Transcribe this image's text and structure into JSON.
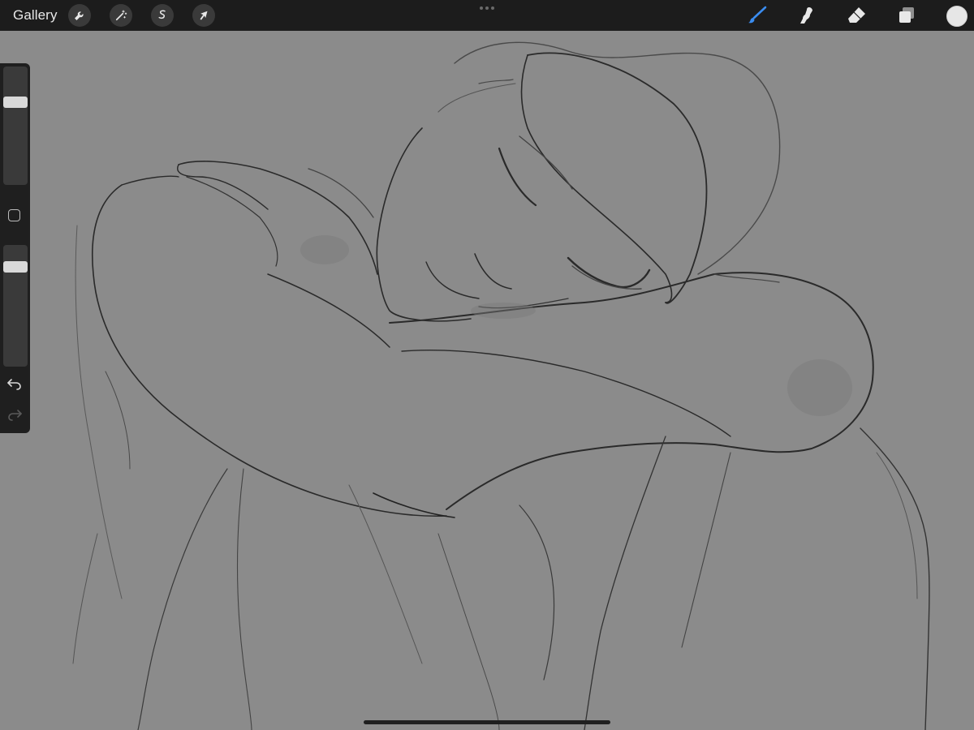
{
  "app": {
    "gallery_label": "Gallery"
  },
  "toolbar": {
    "left_tools": [
      {
        "name": "actions",
        "icon": "wrench-icon"
      },
      {
        "name": "adjustments",
        "icon": "magic-wand-icon"
      },
      {
        "name": "selection",
        "icon": "selection-s-icon"
      },
      {
        "name": "transform",
        "icon": "arrow-cursor-icon"
      }
    ],
    "right_tools": [
      {
        "name": "brush",
        "icon": "brush-icon",
        "active": true
      },
      {
        "name": "smudge",
        "icon": "smudge-icon",
        "active": false
      },
      {
        "name": "eraser",
        "icon": "eraser-icon",
        "active": false
      },
      {
        "name": "layers",
        "icon": "layers-icon",
        "active": false
      }
    ],
    "current_color": "#e6e6e6",
    "active_color": "#3a8cf0"
  },
  "sidebar": {
    "brush_size_fraction": 0.72,
    "brush_opacity_fraction": 0.85,
    "icons": [
      "modifier-square-icon",
      "undo-icon",
      "redo-icon"
    ]
  },
  "canvas": {
    "background_color": "#8b8b8b",
    "artwork": "sketch-sleeping-figure"
  }
}
